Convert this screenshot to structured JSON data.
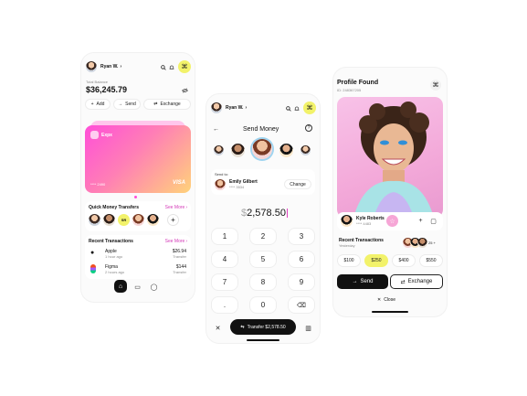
{
  "screen1": {
    "user_name": "Ryan W.",
    "balance_label": "Total Balance",
    "balance": "$36,245.79",
    "actions": [
      "Add",
      "Send",
      "Exchange"
    ],
    "card_brand": "Expx",
    "card_number": "**** 2490",
    "card_network": "VISA",
    "quick_title": "Quick Money Transfers",
    "quick_see_more": "See More",
    "quick_badge": "SR",
    "recent_title": "Recent Transactions",
    "recent_see_more": "See More",
    "transactions": [
      {
        "name": "Apple",
        "time": "1 hour ago",
        "amount": "$26.94",
        "type": "Transfer"
      },
      {
        "name": "Figma",
        "time": "2 hours ago",
        "amount": "$144",
        "type": "Transfer"
      }
    ]
  },
  "screen2": {
    "user_name": "Ryan W.",
    "title": "Send Money",
    "send_to_label": "Send to:",
    "recipient_name": "Emily Gilbert",
    "recipient_number": "**** 3534",
    "change_label": "Change",
    "amount_prefix": "$",
    "amount": "2,578.50",
    "keys": [
      "1",
      "2",
      "3",
      "4",
      "5",
      "6",
      "7",
      "8",
      "9",
      ".",
      "0"
    ],
    "transfer_label": "Transfer $2,578.50"
  },
  "screen3": {
    "title": "Profile Found",
    "profile_id": "ID: 248367205",
    "name": "Kyle Roberts",
    "number": "**** 4483",
    "recent_label": "Recent Transactions",
    "recent_time": "Yesterday",
    "more_count": "25 +",
    "amounts": [
      "$100",
      "$250",
      "$400",
      "$550"
    ],
    "send_label": "Send",
    "exchange_label": "Exchange",
    "close_label": "Close"
  },
  "colors": {
    "accent_yellow": "#f2f26a",
    "dark": "#111111",
    "card_pink": "#ff4fd8",
    "card_yellow": "#ffd27a",
    "profile_bg": "#f6c7e6"
  }
}
